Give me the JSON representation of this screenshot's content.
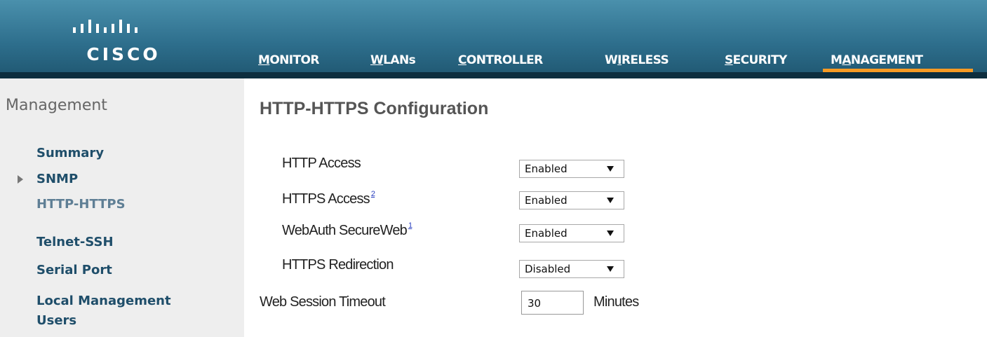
{
  "brand": {
    "name": "CISCO",
    "icon": "cisco-bridge-logo"
  },
  "nav": {
    "items": [
      {
        "key": "M",
        "rest": "ONITOR",
        "label": "MONITOR"
      },
      {
        "key": "W",
        "rest": "LANs",
        "label": "WLANs"
      },
      {
        "key": "C",
        "rest": "ONTROLLER",
        "label": "CONTROLLER"
      },
      {
        "pre": "W",
        "key": "I",
        "rest": "RELESS",
        "label": "WIRELESS"
      },
      {
        "key": "S",
        "rest": "ECURITY",
        "label": "SECURITY"
      },
      {
        "pre": "M",
        "key": "A",
        "rest": "NAGEMENT",
        "label": "MANAGEMENT",
        "active": true
      }
    ],
    "active_underline_color": "#f59a24"
  },
  "sidebar": {
    "title": "Management",
    "items": [
      {
        "label": "Summary"
      },
      {
        "label": "SNMP",
        "expandable": true
      },
      {
        "label": "HTTP-HTTPS",
        "active": true
      },
      {
        "label": "Telnet-SSH"
      },
      {
        "label": "Serial Port"
      },
      {
        "label": "Local Management"
      },
      {
        "label": "Users"
      }
    ]
  },
  "main": {
    "title": "HTTP-HTTPS Configuration",
    "rows": [
      {
        "label": "HTTP Access",
        "value": "Enabled"
      },
      {
        "label": "HTTPS Access",
        "footnote": "2",
        "value": "Enabled"
      },
      {
        "label": "WebAuth SecureWeb",
        "footnote": "1",
        "value": "Enabled"
      },
      {
        "label": "HTTPS Redirection",
        "value": "Disabled"
      }
    ],
    "timeout": {
      "label": "Web Session Timeout",
      "value": "30",
      "unit": "Minutes"
    }
  }
}
